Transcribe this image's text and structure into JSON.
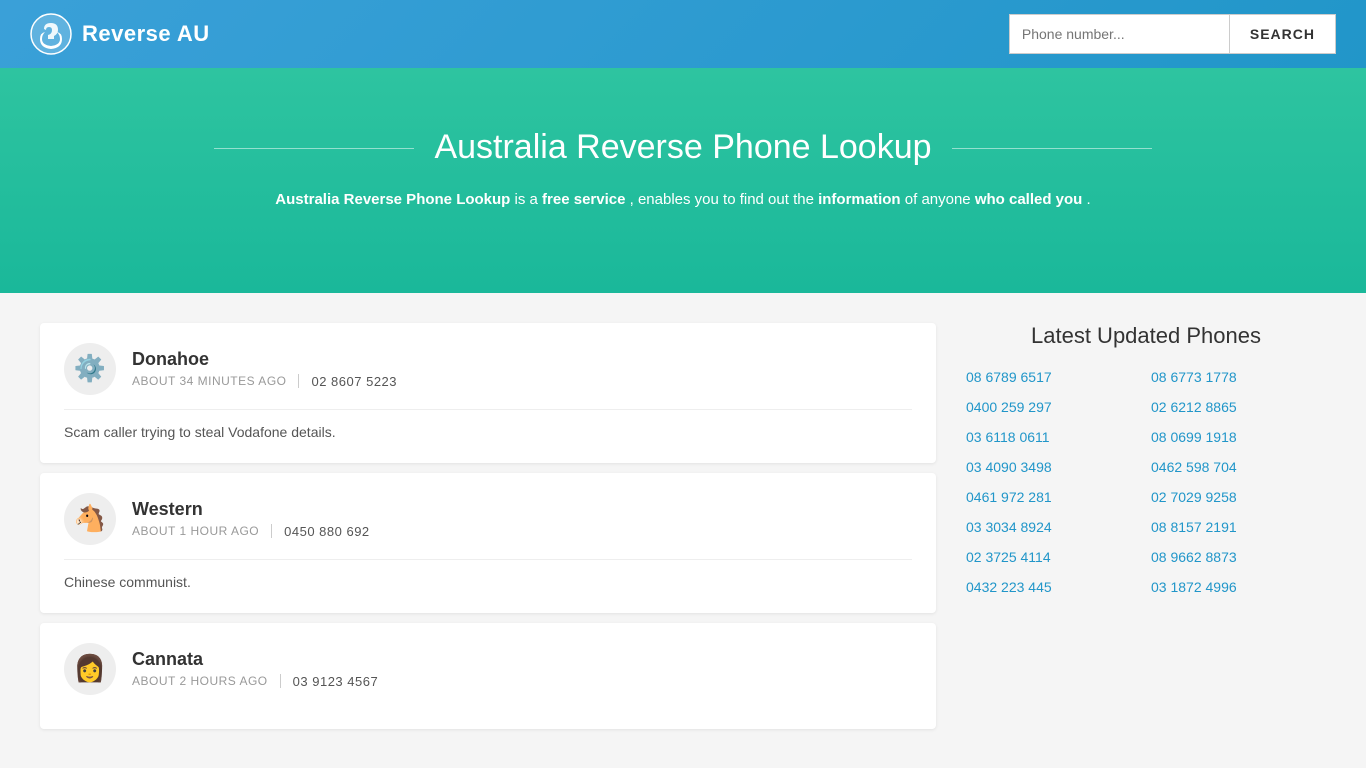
{
  "header": {
    "logo_text": "Reverse AU",
    "search_placeholder": "Phone number...",
    "search_button_label": "SEARCH"
  },
  "hero": {
    "title": "Australia Reverse Phone Lookup",
    "description_parts": [
      {
        "text": "Australia Reverse Phone Lookup",
        "bold": true
      },
      {
        "text": " is a ",
        "bold": false
      },
      {
        "text": "free service",
        "bold": true
      },
      {
        "text": ", enables you to find out the ",
        "bold": false
      },
      {
        "text": "information",
        "bold": true
      },
      {
        "text": " of anyone ",
        "bold": false
      },
      {
        "text": "who called you",
        "bold": true
      },
      {
        "text": ".",
        "bold": false
      }
    ]
  },
  "entries": [
    {
      "name": "Donahoe",
      "time_ago": "ABOUT 34 MINUTES AGO",
      "phone": "02 8607 5223",
      "comment": "Scam caller trying to steal Vodafone details.",
      "avatar_emoji": "⚙️"
    },
    {
      "name": "Western",
      "time_ago": "ABOUT 1 HOUR AGO",
      "phone": "0450 880 692",
      "comment": "Chinese communist.",
      "avatar_emoji": "🐴"
    },
    {
      "name": "Cannata",
      "time_ago": "ABOUT 2 HOURS AGO",
      "phone": "03 9123 4567",
      "comment": "",
      "avatar_emoji": "👩"
    }
  ],
  "latest_phones": {
    "title": "Latest Updated Phones",
    "phones": [
      "08 6789 6517",
      "08 6773 1778",
      "0400 259 297",
      "02 6212 8865",
      "03 6118 0611",
      "08 0699 1918",
      "03 4090 3498",
      "0462 598 704",
      "0461 972 281",
      "02 7029 9258",
      "03 3034 8924",
      "08 8157 2191",
      "02 3725 4114",
      "08 9662 8873",
      "0432 223 445",
      "03 1872 4996"
    ]
  }
}
